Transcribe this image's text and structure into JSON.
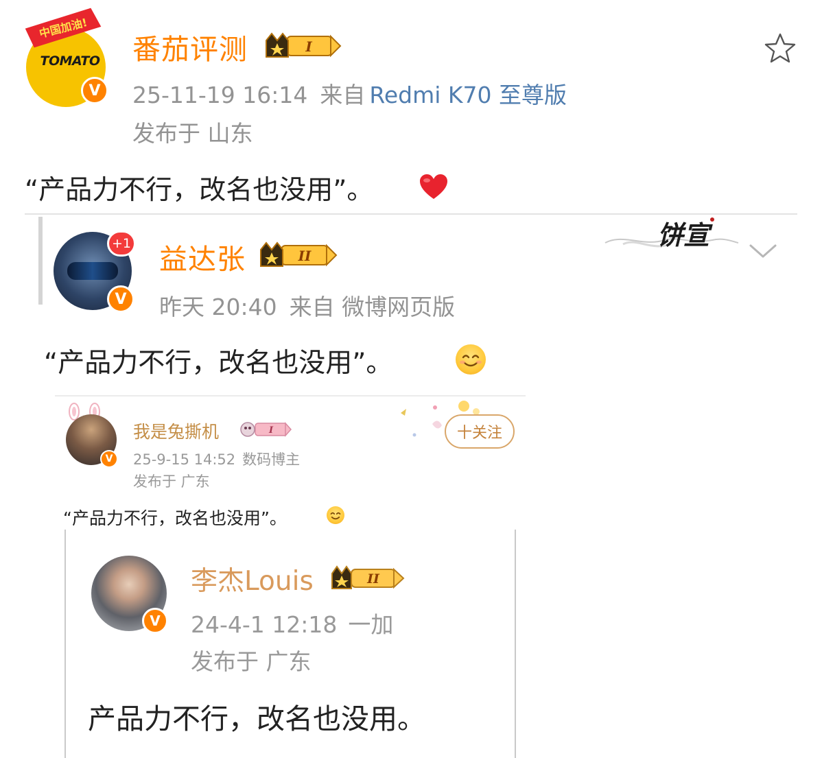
{
  "post": {
    "author": {
      "name": "番茄评测",
      "level": "I",
      "avatar_flag_text": "中国加油!",
      "avatar_brand": "TOMATO",
      "verified_mark": "V"
    },
    "time": "25-11-19 16:14",
    "source_label": "来自",
    "source": "Redmi K70 至尊版",
    "location": "发布于 山东",
    "text": "“产品力不行，改名也没用”。",
    "emoji": "heart-emoji",
    "star_icon": "star-icon"
  },
  "repost1": {
    "author": {
      "name": "益达张",
      "level": "II",
      "verified_mark": "V",
      "badge": "+1"
    },
    "time": "昨天 20:40",
    "source_label": "来自",
    "source": "微博网页版",
    "text": "“产品力不行，改名也没用”。",
    "emoji": "smile-emoji",
    "watermark": "饼宣"
  },
  "repost2": {
    "author": {
      "name": "我是兔撕机",
      "level": "I",
      "verified_mark": "V"
    },
    "time": "25-9-15 14:52",
    "label": "数码博主",
    "location": "发布于 广东",
    "follow_button": "十关注",
    "text": "“产品力不行，改名也没用”。",
    "emoji": "smile-emoji"
  },
  "repost3": {
    "author": {
      "name": "李杰Louis",
      "level": "II",
      "verified_mark": "V"
    },
    "time": "24-4-1 12:18",
    "source": "一加",
    "location": "发布于 广东",
    "text": "产品力不行，改名也没用。"
  },
  "colors": {
    "name_orange": "#ff8200",
    "meta_gray": "#939393",
    "source_blue": "#507daf",
    "verified_orange": "#ff8200",
    "heart_red": "#e8232e"
  }
}
